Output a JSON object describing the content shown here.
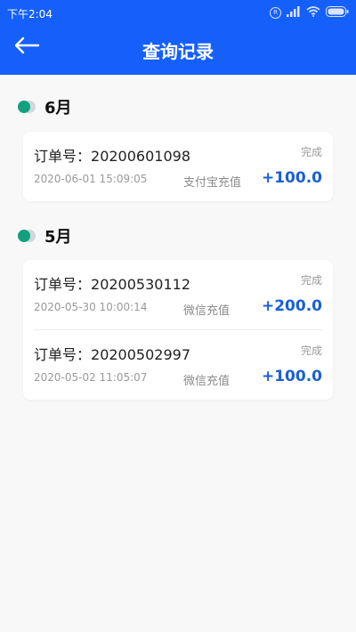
{
  "status_bar": {
    "time": "下午2:04",
    "icons": [
      "registered-icon",
      "signal-icon",
      "wifi-icon",
      "battery-icon"
    ]
  },
  "header": {
    "title": "查询记录",
    "back_icon": "back-arrow-icon"
  },
  "colors": {
    "header_bg": "#1560fb",
    "amount": "#1a5fd9",
    "dot": "#12a17e"
  },
  "sections": [
    {
      "month": "6月",
      "records": [
        {
          "order_label": "订单号：",
          "order_no": "20200601098",
          "status": "完成",
          "datetime": "2020-06-01 15:09:05",
          "method": "支付宝充值",
          "amount": "+100.0"
        }
      ]
    },
    {
      "month": "5月",
      "records": [
        {
          "order_label": "订单号：",
          "order_no": "20200530112",
          "status": "完成",
          "datetime": "2020-05-30 10:00:14",
          "method": "微信充值",
          "amount": "+200.0"
        },
        {
          "order_label": "订单号：",
          "order_no": "20200502997",
          "status": "完成",
          "datetime": "2020-05-02 11:05:07",
          "method": "微信充值",
          "amount": "+100.0"
        }
      ]
    }
  ]
}
